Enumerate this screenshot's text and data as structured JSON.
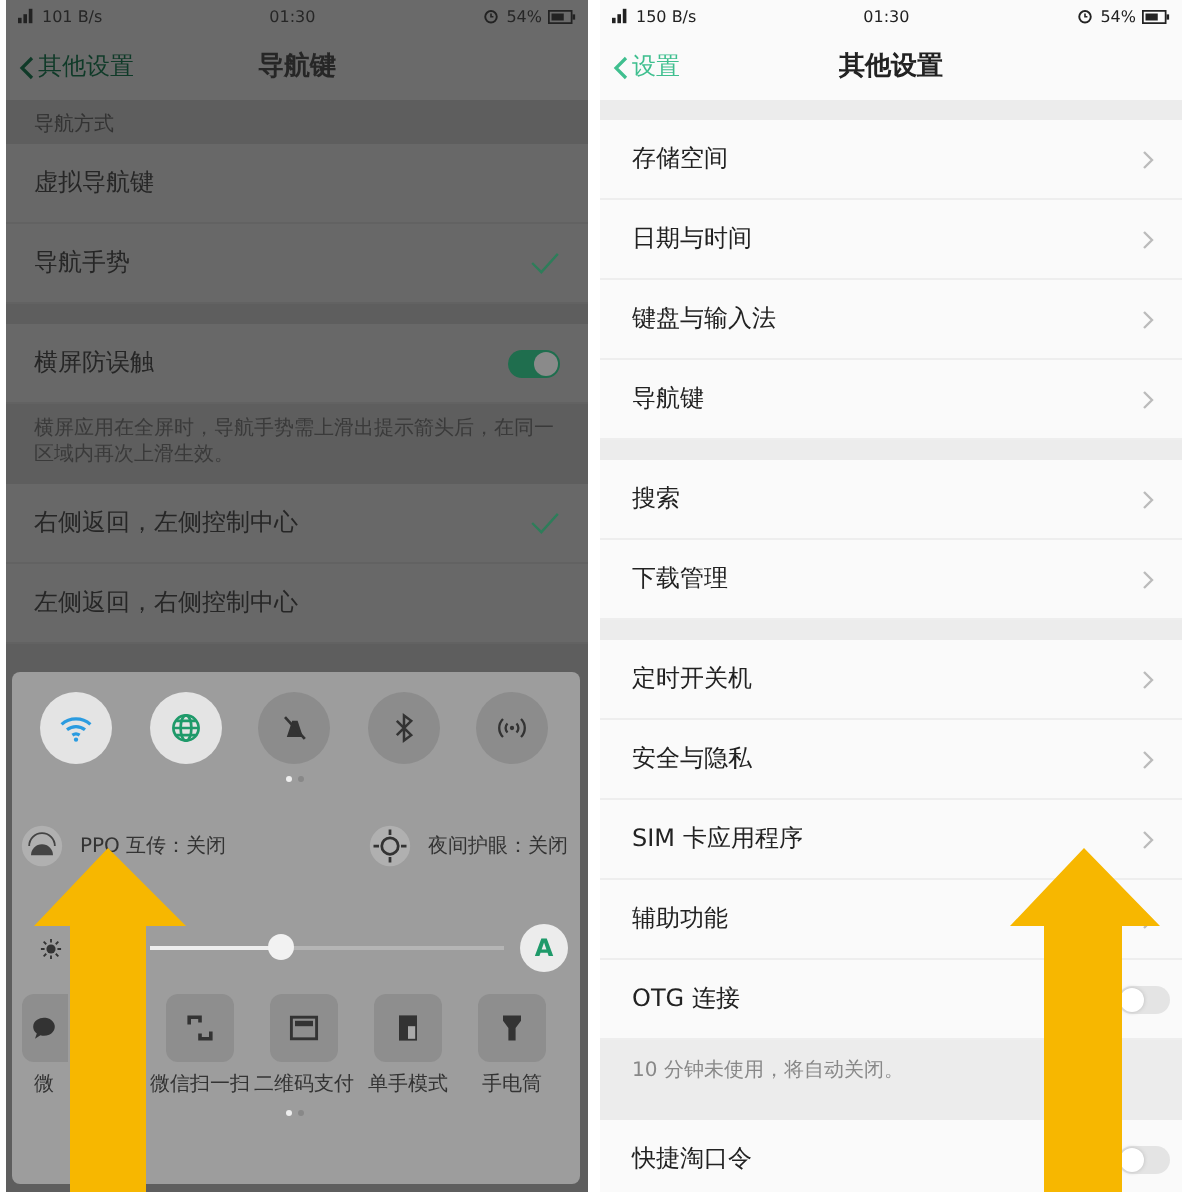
{
  "left_screen": {
    "status_bar": {
      "speed": "101 B/s",
      "time": "01:30",
      "battery": "54%"
    },
    "nav_bar": {
      "back": "其他设置",
      "title": "导航键"
    },
    "section_label": "导航方式",
    "nav_modes": [
      {
        "label": "虚拟导航键",
        "selected": false
      },
      {
        "label": "导航手势",
        "selected": true
      }
    ],
    "landscape_guard": {
      "label": "横屏防误触",
      "on": true
    },
    "landscape_note": "横屏应用在全屏时，导航手势需上滑出提示箭头后，在同一区域内再次上滑生效。",
    "gesture_options": [
      {
        "label": "右侧返回，左侧控制中心",
        "selected": true
      },
      {
        "label": "左侧返回，右侧控制中心",
        "selected": false
      }
    ],
    "control_center": {
      "tiles": [
        {
          "kind": "wifi",
          "on": true
        },
        {
          "kind": "globe",
          "on": true
        },
        {
          "kind": "mute",
          "on": false
        },
        {
          "kind": "bluetooth",
          "on": false
        },
        {
          "kind": "hotspot",
          "on": false
        }
      ],
      "shortcuts": [
        {
          "kind": "share",
          "label": "PPO 互传：关闭"
        },
        {
          "kind": "eye",
          "label": "夜间护眼：关闭"
        }
      ],
      "brightness": {
        "level": 0.37,
        "auto": true,
        "auto_label": "A"
      },
      "apps": [
        {
          "kind": "chat",
          "label": "微"
        },
        {
          "kind": "scan",
          "label": "微信扫一扫"
        },
        {
          "kind": "pay",
          "label": "二维码支付"
        },
        {
          "kind": "onehand",
          "label": "单手模式"
        },
        {
          "kind": "torch",
          "label": "手电筒"
        }
      ]
    }
  },
  "right_screen": {
    "status_bar": {
      "speed": "150 B/s",
      "time": "01:30",
      "battery": "54%"
    },
    "nav_bar": {
      "back": "设置",
      "title": "其他设置"
    },
    "groups": [
      {
        "items": [
          {
            "kind": "link",
            "label": "存储空间"
          },
          {
            "kind": "link",
            "label": "日期与时间"
          },
          {
            "kind": "link",
            "label": "键盘与输入法"
          },
          {
            "kind": "link",
            "label": "导航键"
          }
        ]
      },
      {
        "items": [
          {
            "kind": "link",
            "label": "搜索"
          },
          {
            "kind": "link",
            "label": "下载管理"
          }
        ]
      },
      {
        "items": [
          {
            "kind": "link",
            "label": "定时开关机"
          },
          {
            "kind": "link",
            "label": "安全与隐私"
          },
          {
            "kind": "link",
            "label": "SIM 卡应用程序"
          },
          {
            "kind": "link",
            "label": "辅助功能"
          },
          {
            "kind": "toggle",
            "label": "OTG 连接",
            "on": false
          }
        ],
        "note": "10 分钟未使用，将自动关闭。"
      },
      {
        "items": [
          {
            "kind": "toggle",
            "label": "快捷淘口令",
            "on": false
          }
        ]
      }
    ]
  }
}
